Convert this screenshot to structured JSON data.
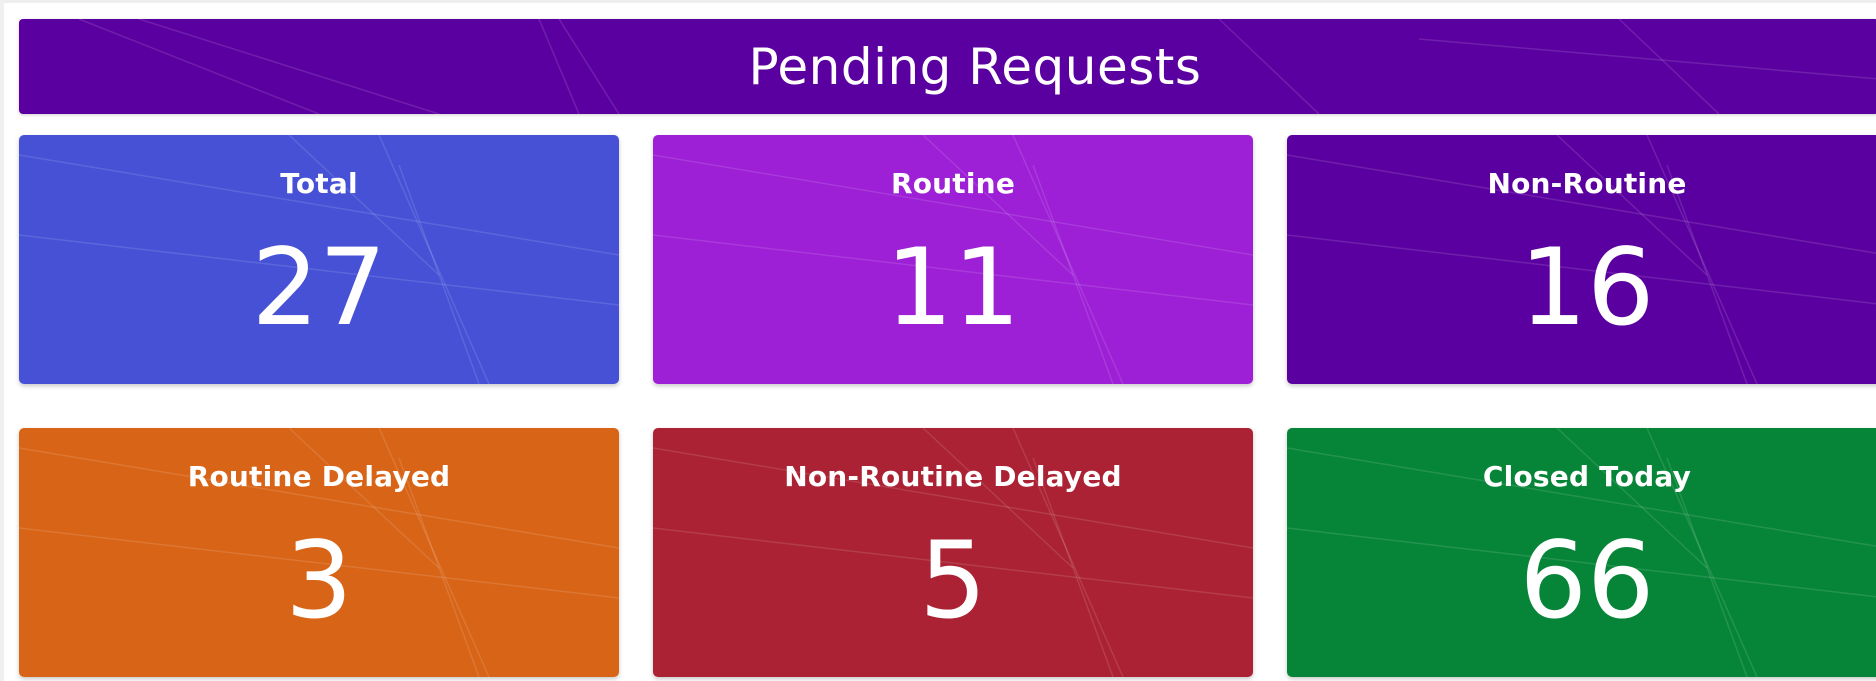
{
  "header": {
    "title": "Pending Requests",
    "color": "#5b00a0"
  },
  "cards": [
    {
      "label": "Total",
      "value": "27",
      "color": "#4651d6"
    },
    {
      "label": "Routine",
      "value": "11",
      "color": "#9d1fd6"
    },
    {
      "label": "Non-Routine",
      "value": "16",
      "color": "#5b00a0"
    },
    {
      "label": "Routine Delayed",
      "value": "3",
      "color": "#d86417"
    },
    {
      "label": "Non-Routine Delayed",
      "value": "5",
      "color": "#aa2233"
    },
    {
      "label": "Closed Today",
      "value": "66",
      "color": "#068538"
    }
  ]
}
